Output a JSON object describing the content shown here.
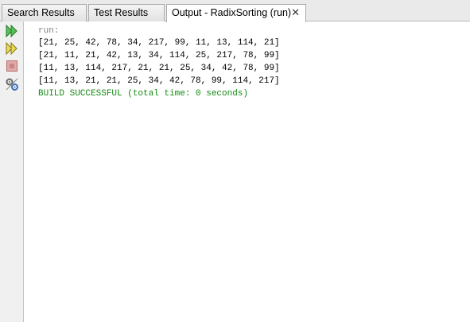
{
  "tabs": [
    {
      "label": "Search Results"
    },
    {
      "label": "Test Results"
    },
    {
      "label": "Output - RadixSorting (run)",
      "close": "✕"
    }
  ],
  "toolbar": {
    "icons": [
      "rerun-icon",
      "rerun-with-options-icon",
      "stop-icon",
      "settings-icon"
    ]
  },
  "output": {
    "run_line": "run:",
    "lines": [
      "[21, 25, 42, 78, 34, 217, 99, 11, 13, 114, 21]",
      "[21, 11, 21, 42, 13, 34, 114, 25, 217, 78, 99]",
      "[11, 13, 114, 217, 21, 21, 25, 34, 42, 78, 99]",
      "[11, 13, 21, 21, 25, 34, 42, 78, 99, 114, 217]"
    ],
    "build_line": "BUILD SUCCESSFUL (total time: 0 seconds)"
  },
  "colors": {
    "success": "#138a13",
    "run": "#808080",
    "rerun_icon": "#2e9e2e",
    "stop_icon": "#d08a8a"
  }
}
